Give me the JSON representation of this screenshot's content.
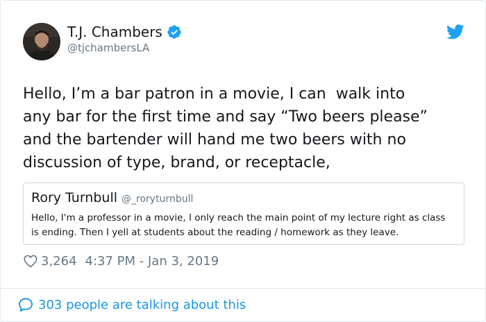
{
  "author": {
    "display_name": "T.J. Chambers",
    "handle": "@tjchambersLA",
    "avatar_icon": "user-avatar",
    "verified": true
  },
  "brand_icon": "twitter-bird-icon",
  "tweet": {
    "text": "Hello, I’m a bar patron in a movie, I can  walk into\nany bar for the first time and say “Two beers please”\nand the bartender will hand me two beers with no\ndiscussion of type, brand, or receptacle,"
  },
  "quoted_tweet": {
    "display_name": "Rory Turnbull",
    "handle": "@_roryturnbull",
    "text": "Hello, I'm a professor in a movie, I only reach the main point of my lecture right as class is ending. Then I yell at students about the reading / homework as they leave."
  },
  "meta": {
    "likes": "3,264",
    "timestamp": "4:37 PM - Jan 3, 2019"
  },
  "footer": {
    "talking_label": "303 people are talking about this"
  },
  "colors": {
    "accent": "#1da1f2",
    "link": "#1b95e0",
    "muted": "#657786",
    "text": "#14171a"
  }
}
